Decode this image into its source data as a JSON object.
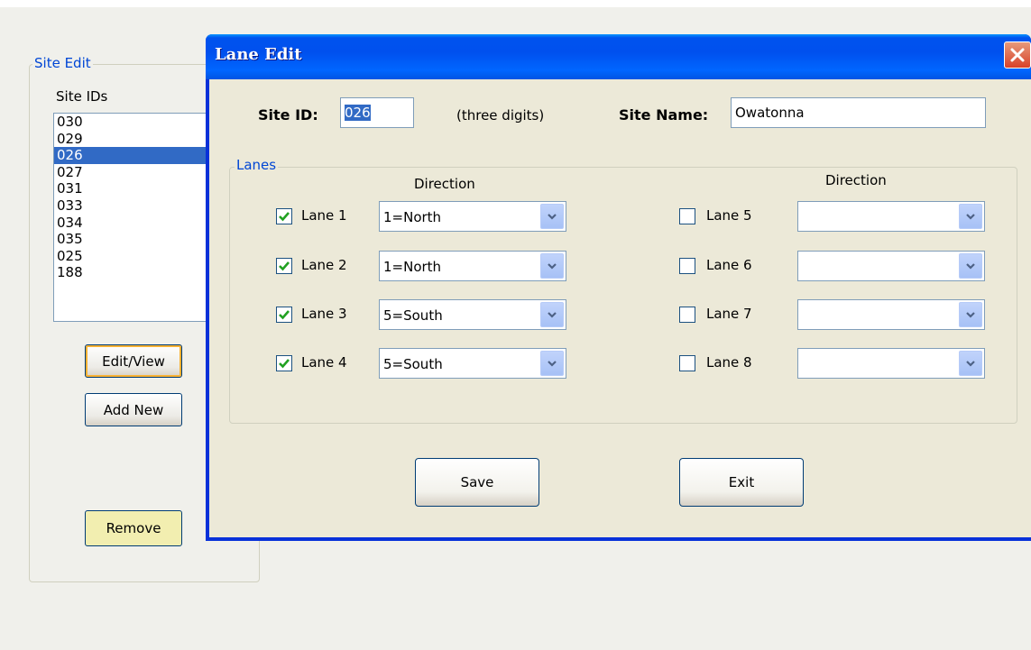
{
  "site_edit": {
    "group_title": "Site Edit",
    "list_label": "Site IDs",
    "site_ids": [
      "030",
      "029",
      "026",
      "027",
      "031",
      "033",
      "034",
      "035",
      "025",
      "188"
    ],
    "selected_site": "026",
    "edit_view_label": "Edit/View",
    "add_new_label": "Add New",
    "remove_label": "Remove"
  },
  "dialog": {
    "title": "Lane Edit",
    "site_id_label": "Site ID:",
    "site_id_value": "026",
    "site_id_hint": "(three digits)",
    "site_name_label": "Site Name:",
    "site_name_value": "Owatonna",
    "lanes_group_title": "Lanes",
    "direction_header_left": "Direction",
    "direction_header_right": "Direction",
    "lanes": [
      {
        "label": "Lane 1",
        "checked": true,
        "direction": "1=North"
      },
      {
        "label": "Lane 2",
        "checked": true,
        "direction": "1=North"
      },
      {
        "label": "Lane 3",
        "checked": true,
        "direction": "5=South"
      },
      {
        "label": "Lane 4",
        "checked": true,
        "direction": "5=South"
      },
      {
        "label": "Lane 5",
        "checked": false,
        "direction": ""
      },
      {
        "label": "Lane 6",
        "checked": false,
        "direction": ""
      },
      {
        "label": "Lane 7",
        "checked": false,
        "direction": ""
      },
      {
        "label": "Lane 8",
        "checked": false,
        "direction": ""
      }
    ],
    "save_label": "Save",
    "exit_label": "Exit"
  },
  "colors": {
    "accent": "#0046d5",
    "selection": "#316ac5",
    "titlebar": "#0054e3",
    "close": "#d8412a"
  },
  "icons": {
    "close": "close-icon",
    "checkmark": "checkmark-icon",
    "dropdown": "chevron-down-icon"
  }
}
